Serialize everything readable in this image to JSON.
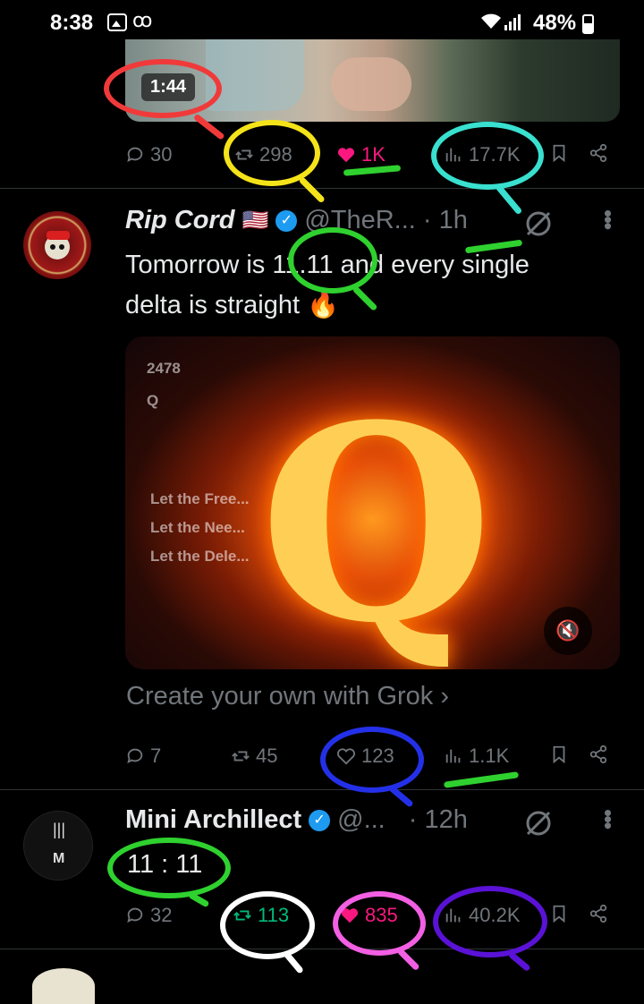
{
  "status_bar": {
    "time": "8:38",
    "voicemail": "ꝏ",
    "battery": "48%"
  },
  "top_tweet": {
    "video_duration": "1:44",
    "replies": "30",
    "reposts": "298",
    "likes": "1K",
    "views": "17.7K"
  },
  "tweet1": {
    "name": "Rip Cord",
    "flag": "🇺🇸",
    "handle": "@TheR...",
    "time": "· 1h",
    "text_line1": "Tomorrow is 11.11 and every single",
    "text_line2": "delta is straight 🔥",
    "media": {
      "letter": "Q",
      "overlay_number": "2478",
      "overlay_q": "Q",
      "overlay_lines": [
        "Let the Free...",
        "Let the Nee...",
        "Let the Dele..."
      ]
    },
    "grok_cta": "Create your own with Grok ›",
    "replies": "7",
    "reposts": "45",
    "likes": "123",
    "views": "1.1K",
    "avatar_text_top": "1st DIVISION",
    "avatar_text_bottom": "RIP"
  },
  "tweet2": {
    "name": "Mini Archillect",
    "handle": "@...",
    "time": "· 12h",
    "text": "11 : 11",
    "avatar_top": "|||",
    "avatar_bottom": "M",
    "replies": "32",
    "reposts": "113",
    "likes": "835",
    "views": "40.2K"
  },
  "colors": {
    "like_active": "#f91880",
    "repost_active": "#00ba7c",
    "verified": "#1d9bf0",
    "muted_text": "#71767b"
  }
}
